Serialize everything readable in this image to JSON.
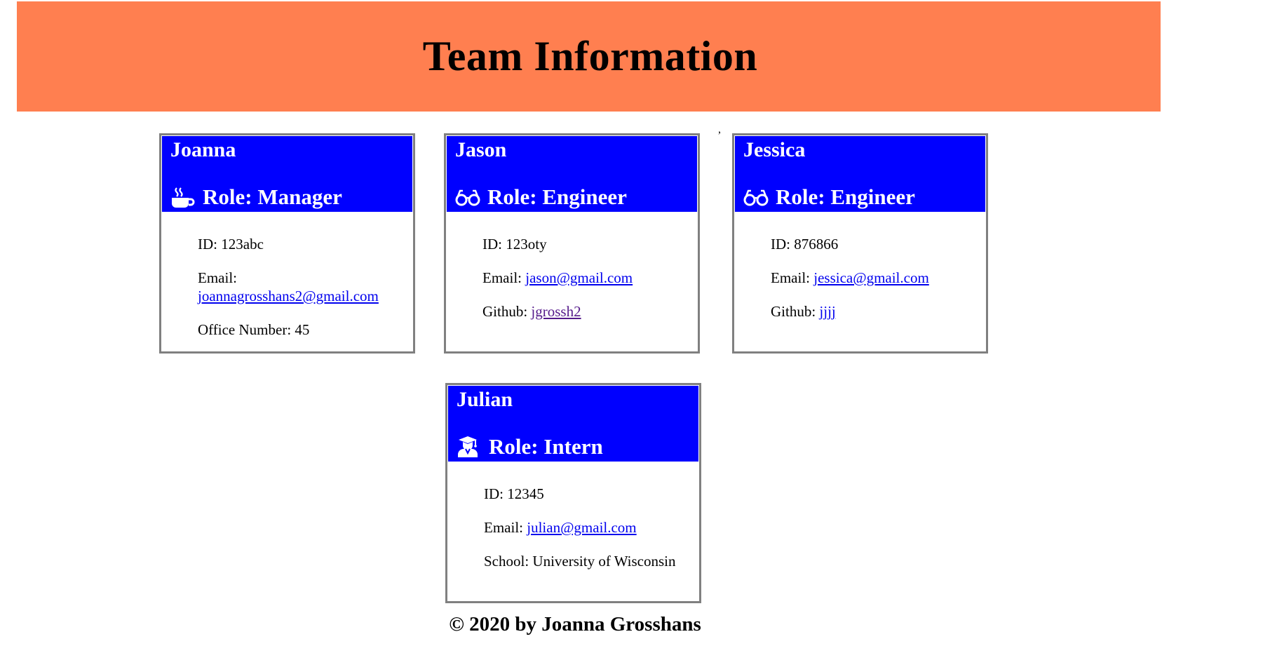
{
  "header": {
    "title": "Team Information"
  },
  "stray_mark": ",",
  "cards": [
    {
      "name": "Joanna",
      "role": "Role: Manager",
      "icon": "coffee-icon",
      "id_label": "ID: 123abc",
      "email_label": "Email:",
      "email": "joannagrosshans2@gmail.com",
      "extra_label": "Office Number: 45"
    },
    {
      "name": "Jason",
      "role": "Role: Engineer",
      "icon": "glasses-icon",
      "id_label": "ID: 123oty",
      "email_label": "Email: ",
      "email": "jason@gmail.com",
      "extra_label": "Github: ",
      "extra_link": "jgrossh2"
    },
    {
      "name": "Jessica",
      "role": "Role: Engineer",
      "icon": "glasses-icon",
      "id_label": "ID: 876866",
      "email_label": "Email: ",
      "email": "jessica@gmail.com",
      "extra_label": "Github: ",
      "extra_link": "jjjj"
    },
    {
      "name": "Julian",
      "role": "Role: Intern",
      "icon": "graduate-icon",
      "id_label": "ID: 12345",
      "email_label": "Email: ",
      "email": "julian@gmail.com",
      "extra_label": "School: University of Wisconsin"
    }
  ],
  "footer": {
    "text": "© 2020 by Joanna Grosshans"
  },
  "colors": {
    "header_bg": "#ff7f50",
    "card_head_bg": "#0000ff",
    "card_border": "#808080",
    "link": "#0000ee",
    "visited_link": "#551a8b"
  }
}
